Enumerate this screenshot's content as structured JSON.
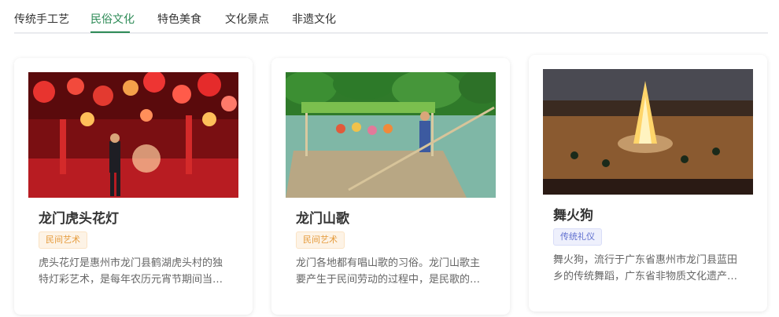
{
  "tabs": [
    {
      "label": "传统手工艺"
    },
    {
      "label": "民俗文化"
    },
    {
      "label": "特色美食"
    },
    {
      "label": "文化景点"
    },
    {
      "label": "非遗文化"
    }
  ],
  "active_tab": "民俗文化",
  "cards": [
    {
      "title": "龙门虎头花灯",
      "tag": "民间艺术",
      "description": "虎头花灯是惠州市龙门县鹤湖虎头村的独特灯彩艺术，是每年农历元宵节期间当地民..."
    },
    {
      "title": "龙门山歌",
      "tag": "民间艺术",
      "description": "龙门各地都有唱山歌的习俗。龙门山歌主要产生于民间劳动的过程中，是民歌的一种..."
    },
    {
      "title": "舞火狗",
      "tag": "传统礼仪",
      "description": "舞火狗，流行于广东省惠州市龙门县蓝田乡的传统舞蹈，广东省非物质文化遗产之一..."
    }
  ],
  "colors": {
    "accent": "#2e8b57",
    "tag_folk_text": "#e59a3a",
    "tag_ritual_text": "#6070cf"
  }
}
